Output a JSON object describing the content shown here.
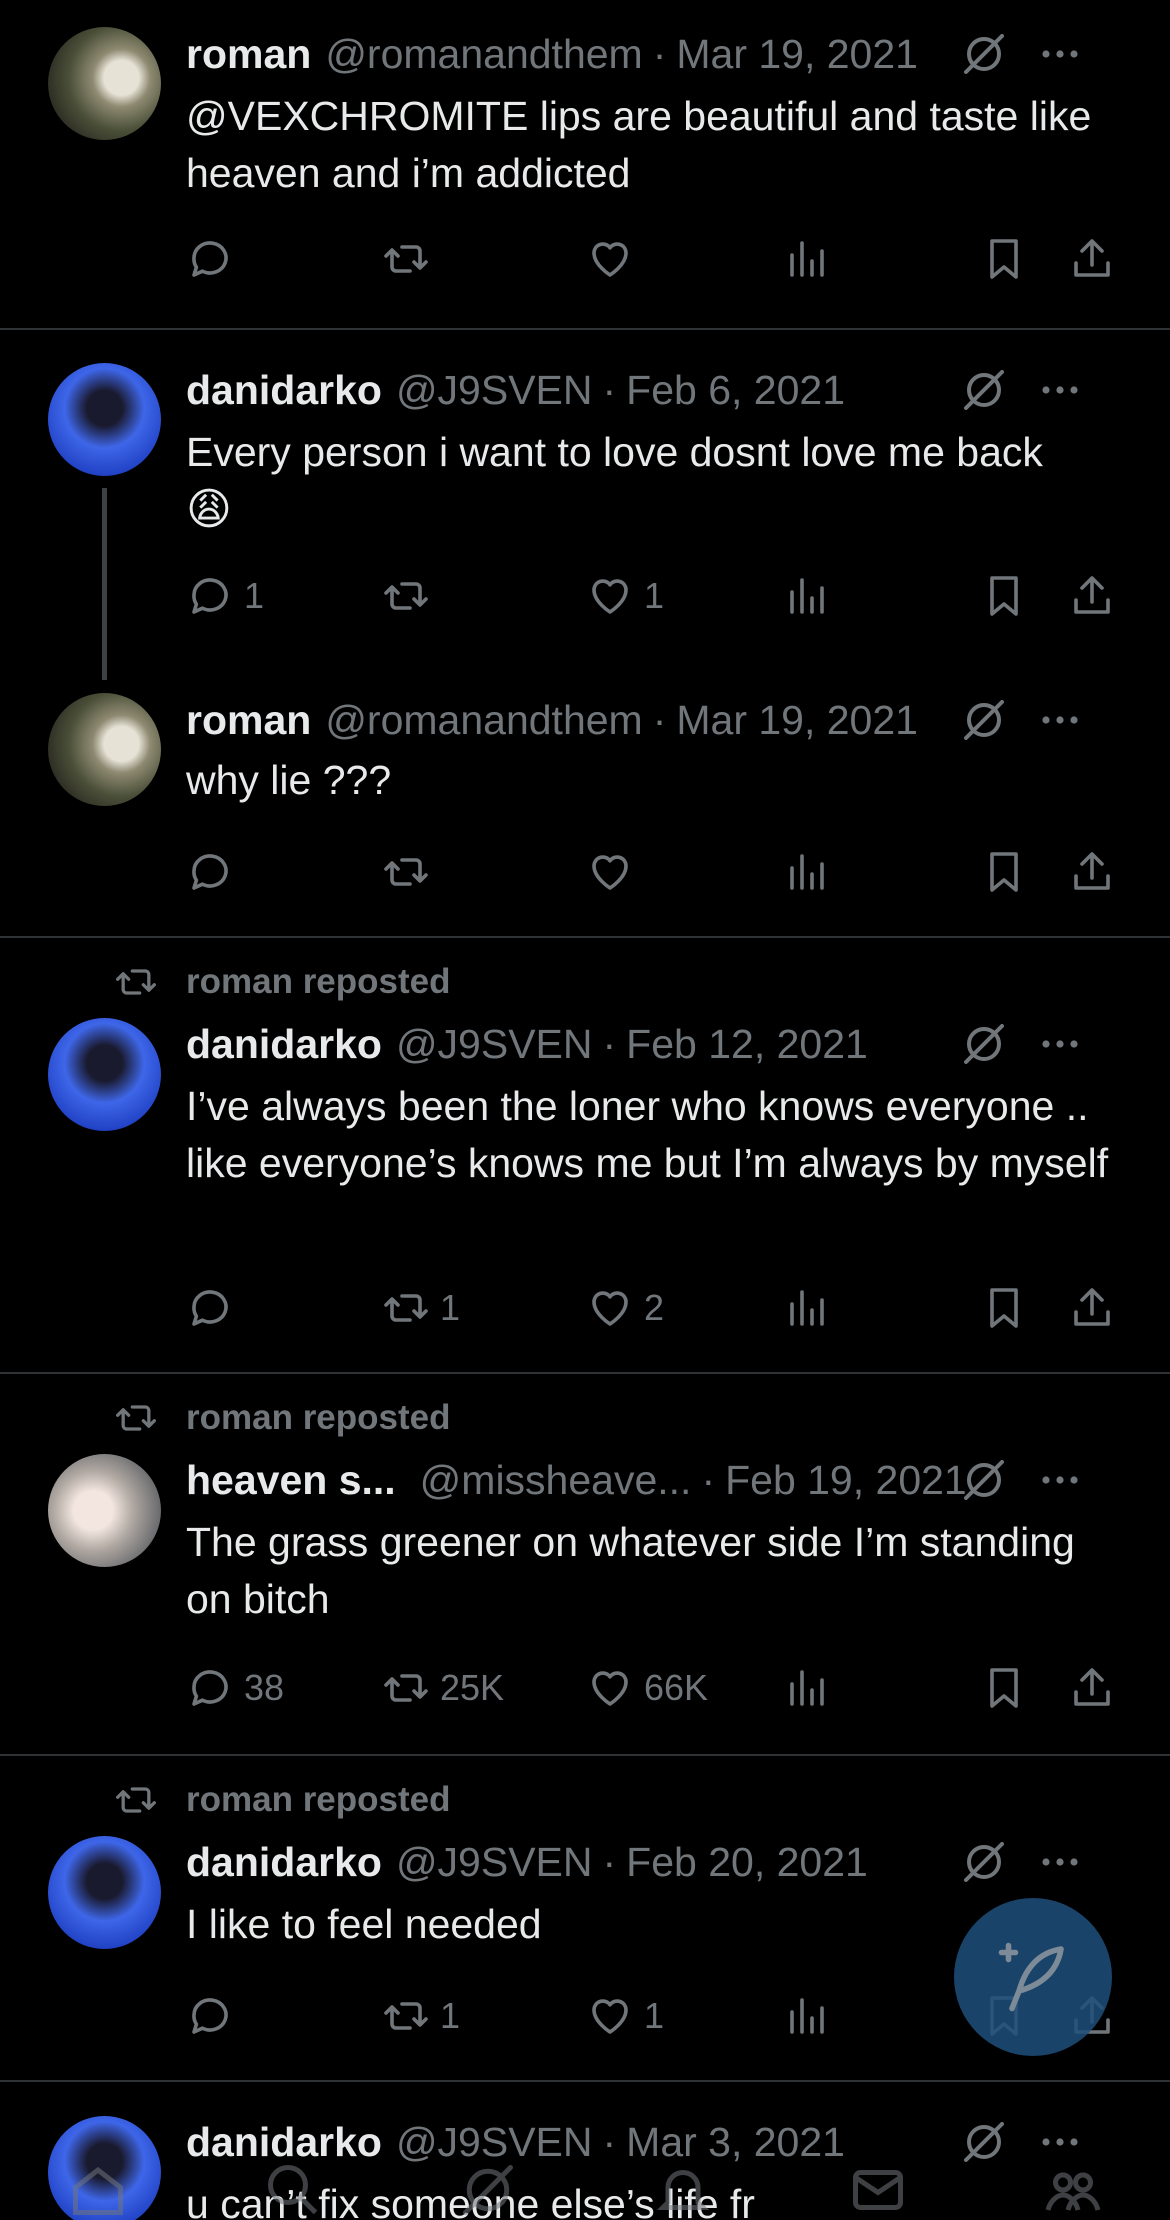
{
  "tweets": [
    {
      "name": "roman",
      "handle": "@romanandthem",
      "date": "Mar 19, 2021",
      "text": "@VEXCHROMITE  lips are beautiful and taste like heaven and i’m addicted",
      "replies": "",
      "reposts": "",
      "likes": ""
    },
    {
      "name": "danidarko",
      "handle": "@J9SVEN",
      "date": "Feb 6, 2021",
      "text": "Every person i want to love dosnt love me back",
      "emoji": "😩",
      "replies": "1",
      "reposts": "",
      "likes": "1"
    },
    {
      "name": "roman",
      "handle": "@romanandthem",
      "date": "Mar 19, 2021",
      "text": "why lie ???",
      "replies": "",
      "reposts": "",
      "likes": ""
    },
    {
      "repost_label": "roman reposted",
      "name": "danidarko",
      "handle": "@J9SVEN",
      "date": "Feb 12, 2021",
      "text": "I’ve always been the loner who knows everyone .. like everyone’s knows me but I’m always by myself",
      "replies": "",
      "reposts": "1",
      "likes": "2"
    },
    {
      "repost_label": "roman reposted",
      "name": "heaven s...",
      "handle": "@missheave...",
      "date": "Feb 19, 2021",
      "text": "The grass greener on whatever side I’m standing on bitch",
      "replies": "38",
      "reposts": "25K",
      "likes": "66K"
    },
    {
      "repost_label": "roman reposted",
      "name": "danidarko",
      "handle": "@J9SVEN",
      "date": "Feb 20, 2021",
      "text": "I like to feel needed",
      "replies": "",
      "reposts": "1",
      "likes": "1"
    },
    {
      "name": "danidarko",
      "handle": "@J9SVEN",
      "date": "Mar 3, 2021",
      "text": "u can’t fix someone else’s life fr"
    }
  ],
  "separator": "·",
  "icons": {
    "reply": "reply-icon",
    "repost": "repost-icon",
    "like": "heart-icon",
    "views": "views-icon",
    "bookmark": "bookmark-icon",
    "share": "share-icon",
    "grok": "grok-icon",
    "more": "more-icon",
    "compose": "compose-icon"
  },
  "colors": {
    "background": "#000000",
    "text": "#e7e9ea",
    "muted": "#71767b",
    "fab": "#1d4f7a"
  }
}
